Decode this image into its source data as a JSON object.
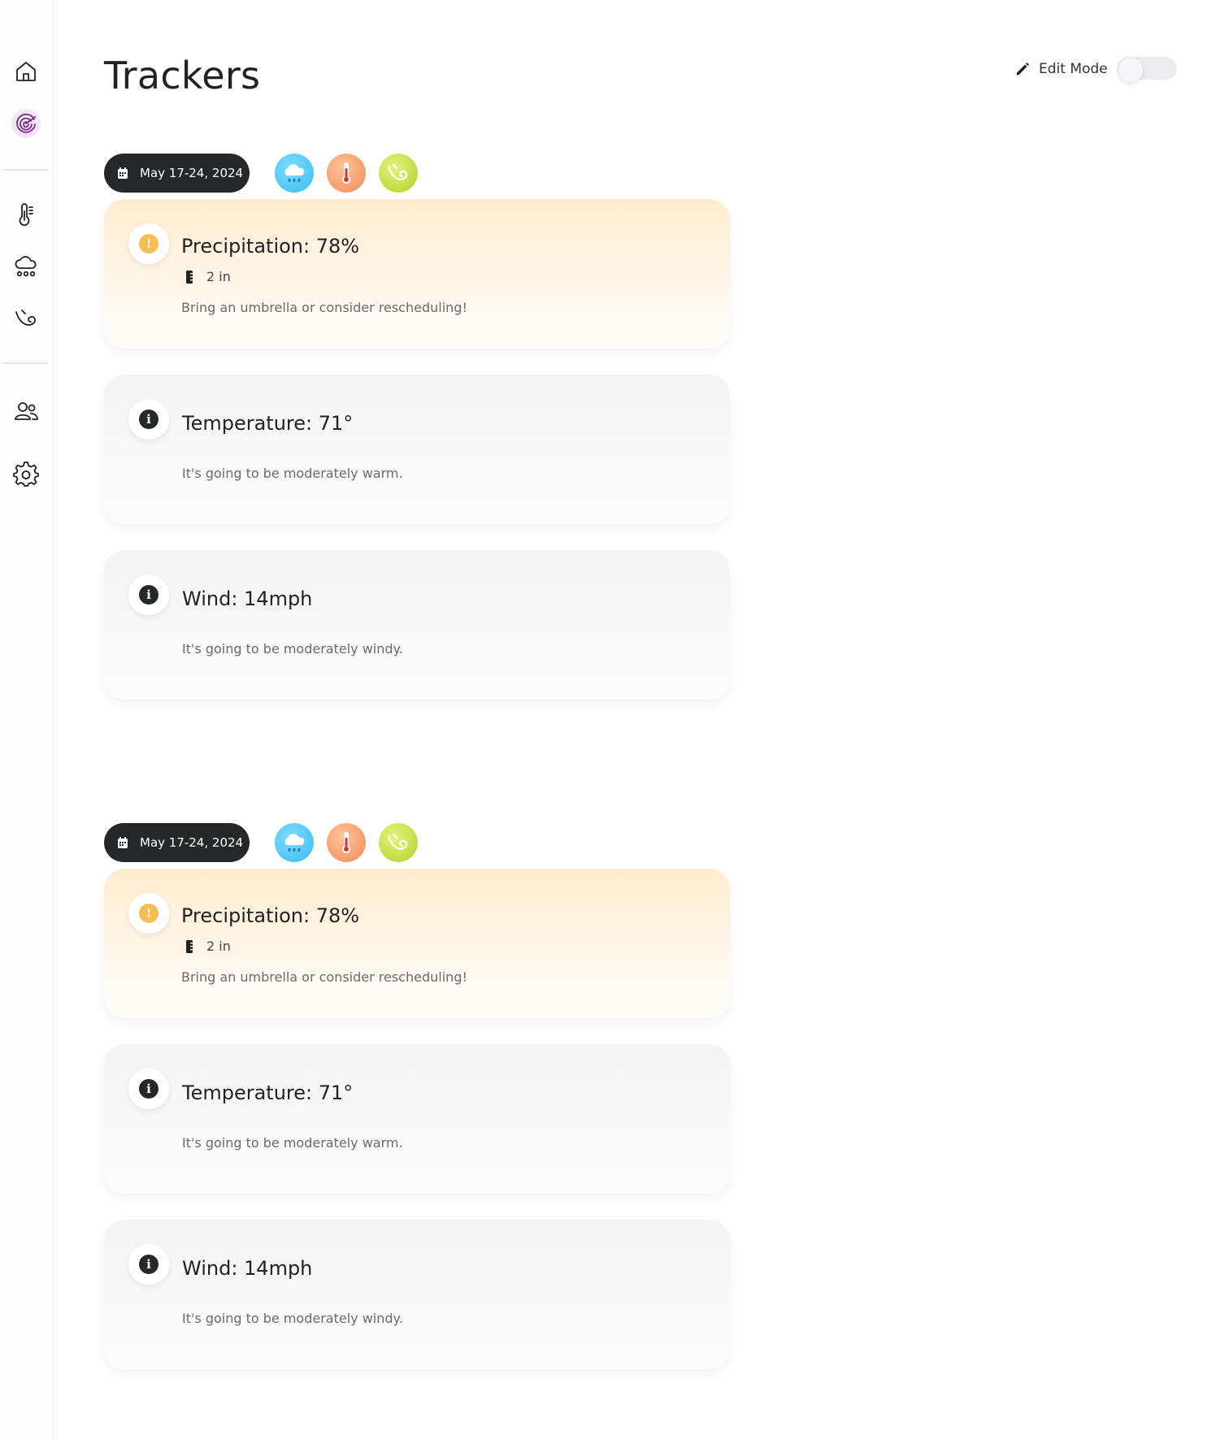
{
  "sidebar": {
    "items": [
      {
        "name": "home",
        "icon": "home-icon"
      },
      {
        "name": "trackers",
        "icon": "radar-icon",
        "active": true
      },
      {
        "name": "temperature",
        "icon": "thermometer-icon"
      },
      {
        "name": "precipitation",
        "icon": "rain-cloud-icon"
      },
      {
        "name": "wind",
        "icon": "wind-icon"
      },
      {
        "name": "people",
        "icon": "users-icon"
      },
      {
        "name": "settings",
        "icon": "gear-icon"
      }
    ]
  },
  "header": {
    "title": "Trackers",
    "edit_mode_label": "Edit Mode",
    "edit_mode_on": false
  },
  "groups": [
    {
      "date_range": "May 17-24, 2024",
      "filters": [
        "rain-cloud-icon",
        "thermometer-icon",
        "wind-icon"
      ],
      "cards": {
        "precipitation": {
          "title": "Precipitation: 78%",
          "amount": "2 in",
          "note": "Bring an umbrella or consider rescheduling!",
          "status": "warning"
        },
        "temperature": {
          "title": "Temperature: 71°",
          "note": "It's going to be moderately warm.",
          "status": "info"
        },
        "wind": {
          "title": "Wind: 14mph",
          "note": "It's going to be moderately windy.",
          "status": "info"
        }
      }
    },
    {
      "date_range": "May 17-24, 2024",
      "filters": [
        "rain-cloud-icon",
        "thermometer-icon",
        "wind-icon"
      ],
      "cards": {
        "precipitation": {
          "title": "Precipitation: 78%",
          "amount": "2 in",
          "note": "Bring an umbrella or consider rescheduling!",
          "status": "warning"
        },
        "temperature": {
          "title": "Temperature: 71°",
          "note": "It's going to be moderately warm.",
          "status": "info"
        },
        "wind": {
          "title": "Wind: 14mph",
          "note": "It's going to be moderately windy.",
          "status": "info"
        }
      }
    }
  ],
  "colors": {
    "accent_active": "#7a2c8c",
    "pill_bg": "#26272b",
    "warning": "#f6bd55",
    "rain_chip": "#3bbcf0",
    "temp_chip": "#f08a55",
    "wind_chip": "#b1d22b"
  }
}
